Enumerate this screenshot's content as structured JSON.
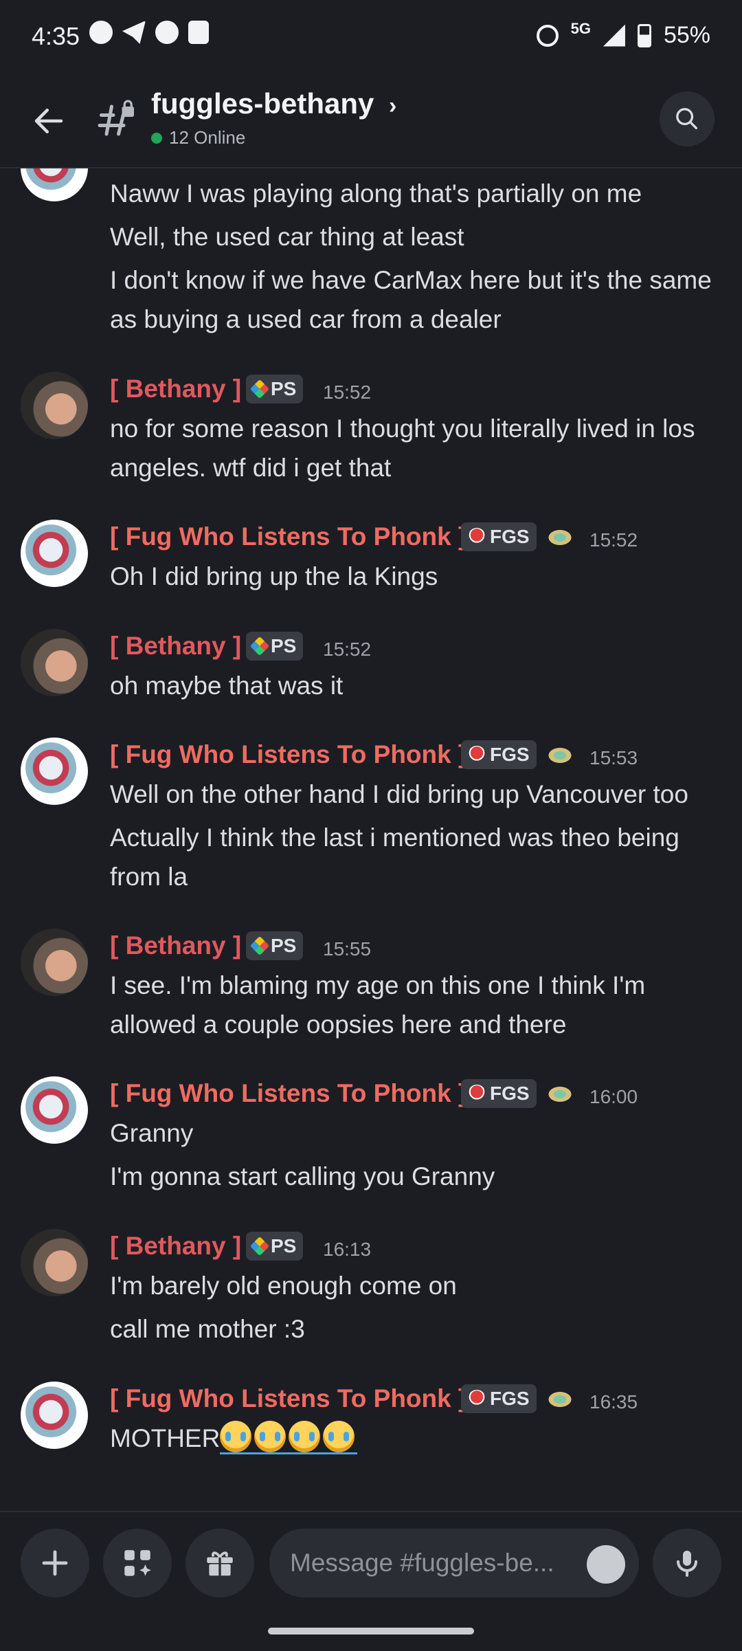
{
  "status_bar": {
    "time": "4:35",
    "network": "5G",
    "battery": "55%"
  },
  "header": {
    "channel_name": "fuggles-bethany",
    "online_text": "12 Online"
  },
  "users": {
    "bethany": {
      "name": "[ Bethany ]",
      "tag": "PS"
    },
    "fug": {
      "name": "[ Fug Who Listens To Phonk ]",
      "tag": "FGS"
    }
  },
  "messages": [
    {
      "lines": [
        "Naww I was playing along that's partially on me",
        "Well, the used car thing at least",
        "I don't know if we have CarMax here but it's the same as buying a used car from a dealer"
      ]
    },
    {
      "user": "bethany",
      "time": "15:52",
      "lines": [
        "no for some reason I thought you literally lived in los angeles. wtf did i get that"
      ]
    },
    {
      "user": "fug",
      "time": "15:52",
      "lines": [
        "Oh I did bring up the la Kings"
      ]
    },
    {
      "user": "bethany",
      "time": "15:52",
      "lines": [
        "oh maybe that was it"
      ]
    },
    {
      "user": "fug",
      "time": "15:53",
      "lines": [
        "Well on the other hand I did bring up Vancouver too",
        "Actually I think the last i mentioned was theo being from la"
      ]
    },
    {
      "user": "bethany",
      "time": "15:55",
      "lines": [
        "I see. I'm blaming my age on this one I think I'm allowed a couple oopsies here and there"
      ]
    },
    {
      "user": "fug",
      "time": "16:00",
      "lines": [
        "Granny",
        "I'm gonna start calling you Granny"
      ]
    },
    {
      "user": "bethany",
      "time": "16:13",
      "lines": [
        "I'm barely old enough come on",
        "call me mother :3"
      ]
    },
    {
      "user": "fug",
      "time": "16:35",
      "lines": [
        "MOTHER"
      ]
    }
  ],
  "composer": {
    "placeholder": "Message #fuggles-be..."
  },
  "icons": {
    "back": "arrow-left-icon",
    "channel": "private-channel-icon",
    "search": "search-icon",
    "add": "plus-icon",
    "apps": "apps-icon",
    "gift": "gift-icon",
    "emoji": "emoji-icon",
    "mic": "microphone-icon"
  }
}
